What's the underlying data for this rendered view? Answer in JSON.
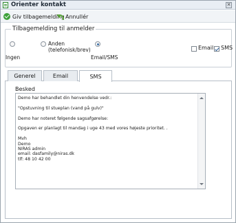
{
  "window": {
    "title": "Orienter kontakt",
    "close_label": "✕"
  },
  "toolbar": {
    "give_label": "Giv tilbagemelding",
    "cancel_label": "Annullér"
  },
  "feedback": {
    "legend": "Tilbagemelding til anmelder",
    "options": [
      {
        "line1": "",
        "line2": "Ingen",
        "checked": false
      },
      {
        "line1": "Anden",
        "line2": "(telefonisk/brev)",
        "checked": false
      },
      {
        "line1": "",
        "line2": "Email/SMS",
        "checked": true
      }
    ],
    "channels": [
      {
        "label": "Email",
        "checked": false
      },
      {
        "label": "SMS",
        "checked": true
      }
    ]
  },
  "tabs": [
    {
      "label": "Generel",
      "active": false
    },
    {
      "label": "Email",
      "active": false
    },
    {
      "label": "SMS",
      "active": true
    }
  ],
  "message": {
    "label": "Besked",
    "text": "Demo har behandlet din henvendelse vedr.:\n\n\"Opstuvning til stueplan (vand på gulv)\"\n\nDemo har noteret følgende sagsafgørelse:\n\nOpgaven er planlagt til mandag i uge 43 med vores højeste prioritet. .\n\nMvh\nDemo\nNIRAS admin\nemail: dasfamily@niras.dk\ntlf: 48 10 42 00"
  }
}
